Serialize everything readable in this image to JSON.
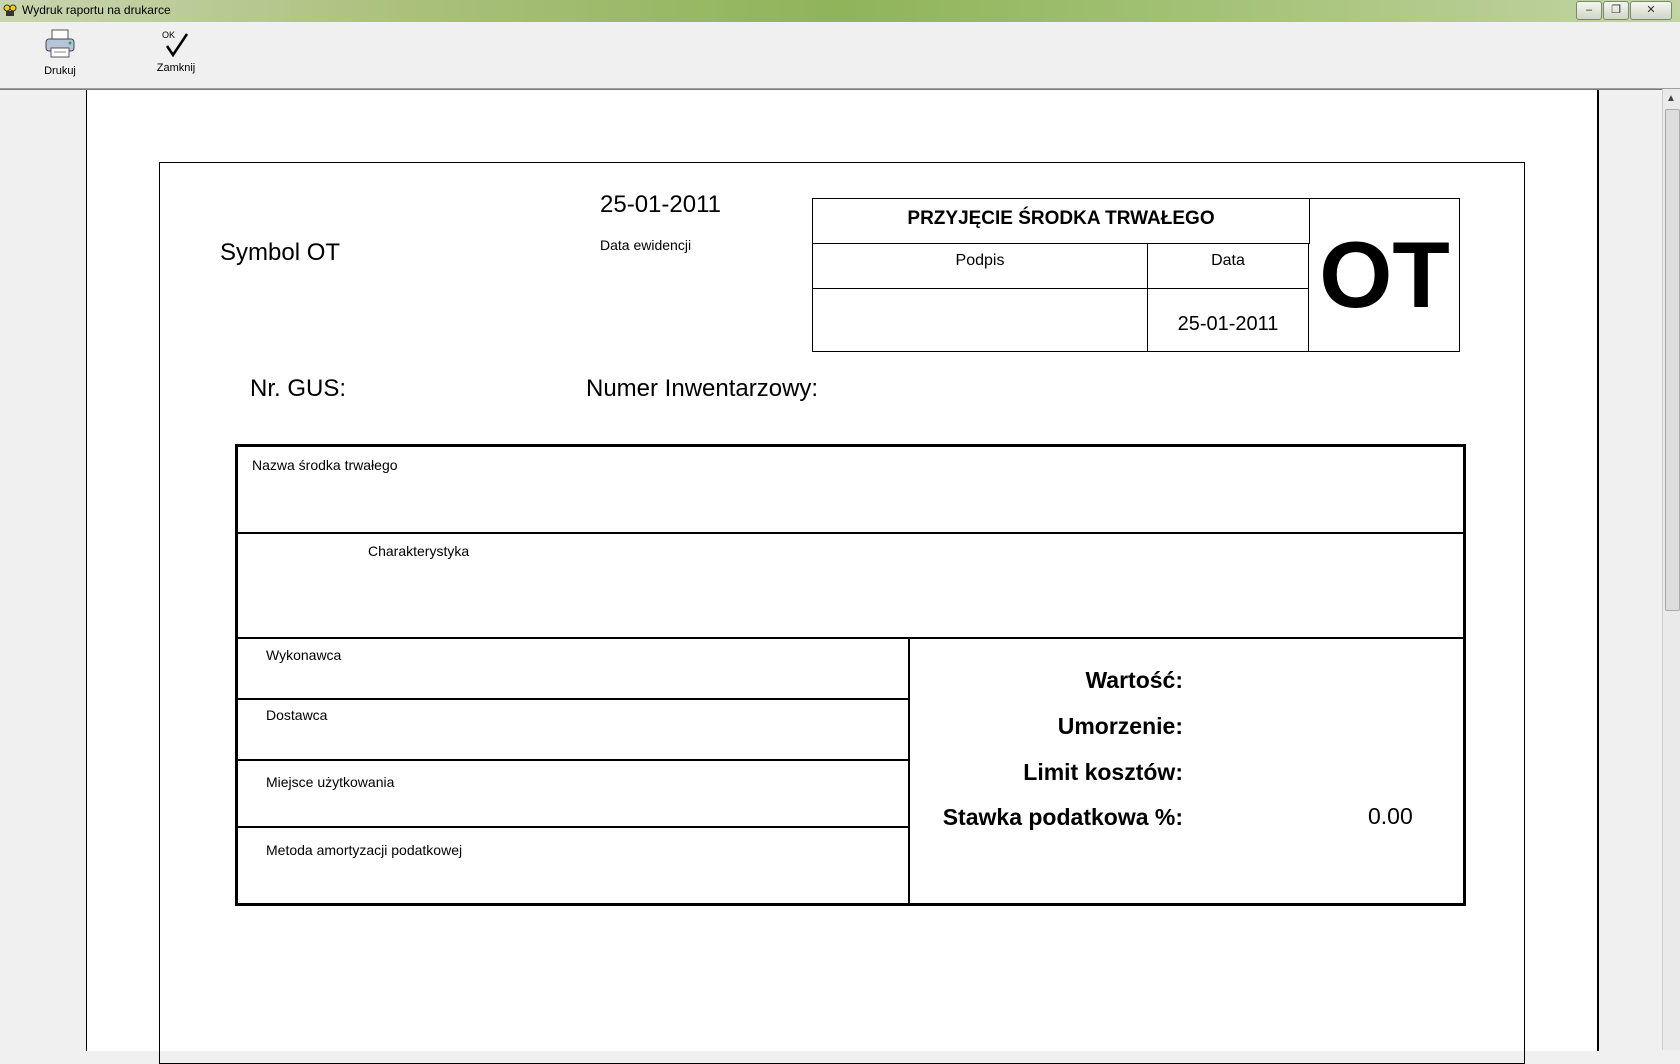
{
  "window": {
    "title": "Wydruk raportu na drukarce"
  },
  "toolbar": {
    "print_label": "Drukuj",
    "close_label": "Zamknij",
    "close_ok": "OK"
  },
  "form": {
    "symbol": "Symbol OT",
    "date": "25-01-2011",
    "date_label": "Data ewidencji",
    "header": {
      "title": "PRZYJĘCIE ŚRODKA TRWAŁEGO",
      "podpis": "Podpis",
      "data": "Data",
      "data_value": "25-01-2011",
      "code": "OT"
    },
    "nr_gus": "Nr. GUS:",
    "nr_inw": "Numer Inwentarzowy:",
    "fields": {
      "nazwa": "Nazwa środka trwałego",
      "charakterystyka": "Charakterystyka",
      "wykonawca": "Wykonawca",
      "dostawca": "Dostawca",
      "miejsce": "Miejsce użytkowania",
      "metoda": "Metoda amortyzacji podatkowej"
    },
    "values": {
      "wartosc": "Wartość:",
      "umorzenie": "Umorzenie:",
      "limit": "Limit kosztów:",
      "stawka": "Stawka podatkowa %:",
      "stawka_value": "0.00"
    }
  }
}
